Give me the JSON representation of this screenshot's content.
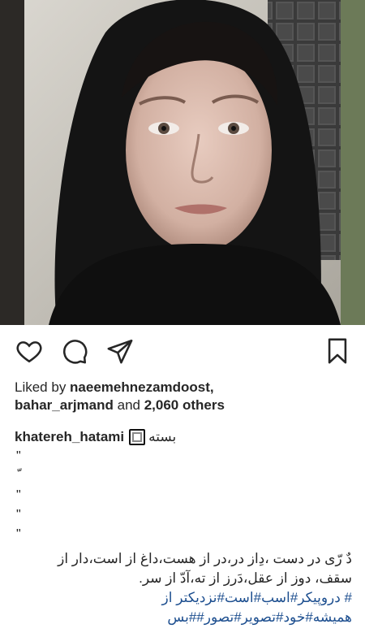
{
  "post": {
    "image_alt": "Selfie of a woman wearing a black hoodie against a tiled wall"
  },
  "actions": {
    "like_icon": "heart-icon",
    "comment_icon": "comment-icon",
    "share_icon": "send-icon",
    "save_icon": "bookmark-icon"
  },
  "likes": {
    "prefix": "Liked by ",
    "user1": "naeemehnezamdoost,",
    "user2": "bahar_arjmand",
    "middle": " and ",
    "count": "2,060 others"
  },
  "caption": {
    "username": "khatereh_hatami",
    "title": "بسته",
    "marks": [
      "\"",
      "ّ",
      "\"",
      "\"",
      "\""
    ],
    "line1": "دٌ رّی در دست ،دِاز در،در از هست،داغ از است،دار از",
    "line2": "سقف، دوز از عقل،دَرز از ته،آدّ از سر.",
    "line3_hash": "# دروپیکر#اسب#است#نزدیکتر از",
    "line4_hash": "همیشه#خود#تصویر#تصور##بس"
  },
  "colors": {
    "hashtag": "#1c4e8f",
    "text": "#262626"
  }
}
